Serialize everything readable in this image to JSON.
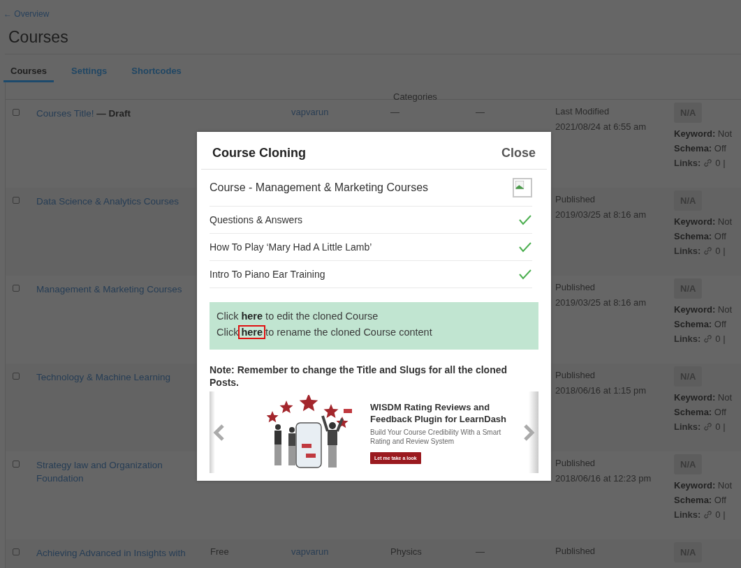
{
  "back_link": "← Overview",
  "page_title": "Courses",
  "tabs": [
    {
      "label": "Courses",
      "selected": true
    },
    {
      "label": "Settings",
      "selected": false
    },
    {
      "label": "Shortcodes",
      "selected": false
    }
  ],
  "table": {
    "header_categories": "Categories",
    "rows": [
      {
        "checked": false,
        "title": "Courses Title!",
        "status": "— Draft",
        "author": "vapvarun",
        "categories": "—",
        "tags": "—",
        "date_label": "Last Modified",
        "date": "2021/08/24 at 6:55 am",
        "seo": {
          "score": "N/A",
          "keyword_label": "Keyword:",
          "keyword": "Not",
          "schema_label": "Schema:",
          "schema": "Off",
          "links_label": "Links:",
          "links": "0 |"
        }
      },
      {
        "checked": false,
        "title": "Data Science & Analytics Courses",
        "date_label": "Published",
        "date": "2019/03/25 at 8:16 am",
        "seo": {
          "score": "N/A",
          "keyword_label": "Keyword:",
          "keyword": "Not",
          "schema_label": "Schema:",
          "schema": "Off",
          "links_label": "Links:",
          "links": "0 |"
        }
      },
      {
        "checked": false,
        "title": "Management & Marketing Courses",
        "date_label": "Published",
        "date": "2019/03/25 at 8:16 am",
        "seo": {
          "score": "N/A",
          "keyword_label": "Keyword:",
          "keyword": "Not",
          "schema_label": "Schema:",
          "schema": "Off",
          "links_label": "Links:",
          "links": "0 |"
        }
      },
      {
        "checked": false,
        "title": "Technology & Machine Learning",
        "date_label": "Published",
        "date": "2018/06/16 at 1:15 pm",
        "seo": {
          "score": "N/A",
          "keyword_label": "Keyword:",
          "keyword": "Not",
          "schema_label": "Schema:",
          "schema": "Off",
          "links_label": "Links:",
          "links": "0 |"
        }
      },
      {
        "checked": false,
        "title": "Strategy law and Organization Foundation",
        "date_label": "Published",
        "date": "2018/06/16 at 12:23 pm",
        "seo": {
          "score": "N/A",
          "keyword_label": "Keyword:",
          "keyword": "Not",
          "schema_label": "Schema:",
          "schema": "Off",
          "links_label": "Links:",
          "links": "0 |"
        }
      },
      {
        "checked": false,
        "title": "Achieving Advanced in Insights with",
        "price": "Free",
        "author": "vapvarun",
        "categories": "Physics",
        "tags": "—",
        "date_label": "Published",
        "seo": {
          "score": "N/A"
        }
      }
    ]
  },
  "modal": {
    "title": "Course Cloning",
    "close": "Close",
    "course": "Course - Management & Marketing Courses",
    "items": [
      {
        "label": "Questions & Answers",
        "done": true
      },
      {
        "label": "How To Play ‘Mary Had A Little Lamb’",
        "done": true
      },
      {
        "label": "Intro To Piano Ear Training",
        "done": true
      }
    ],
    "messages": [
      {
        "before": "Click ",
        "link": "here",
        "after": " to edit the cloned Course",
        "highlighted": false
      },
      {
        "before": "Click ",
        "link": "here",
        "after": " to rename the cloned Course content",
        "highlighted": true
      }
    ],
    "note": "Note: Remember to change the Title and Slugs for all the cloned Posts.",
    "banner": {
      "title": "WISDM Rating Reviews and Feedback Plugin for LearnDash",
      "subtitle": "Build Your Course Credibility With a Smart Rating and Review System",
      "button": "Let me take a look"
    }
  }
}
